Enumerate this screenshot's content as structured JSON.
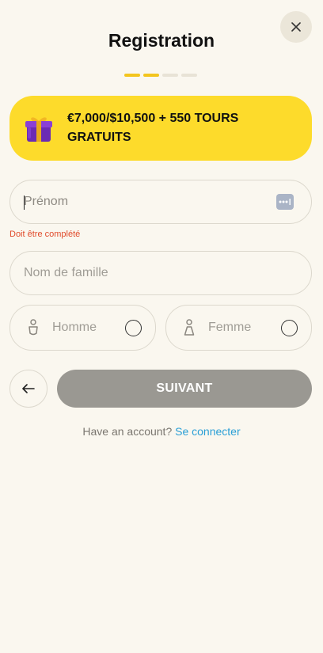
{
  "header": {
    "title": "Registration",
    "close_icon": "close-icon",
    "steps_total": 4,
    "steps_active": 2
  },
  "banner": {
    "icon": "gift-icon",
    "text": "€7,000/$10,500 + 550 TOURS GRATUITS",
    "background": "#fddb2b"
  },
  "form": {
    "first_name": {
      "placeholder": "Prénom",
      "value": "",
      "error": "Doit être complété"
    },
    "last_name": {
      "placeholder": "Nom de famille",
      "value": ""
    },
    "gender": {
      "male_label": "Homme",
      "female_label": "Femme"
    }
  },
  "actions": {
    "back_icon": "arrow-left-icon",
    "next_label": "SUIVANT"
  },
  "footer": {
    "question": "Have an account?",
    "link": "Se connecter"
  },
  "colors": {
    "background": "#faf7ef",
    "accent": "#f3c51e",
    "error": "#e04a2a",
    "link": "#2a9fd6",
    "button_disabled": "#9a9892"
  }
}
